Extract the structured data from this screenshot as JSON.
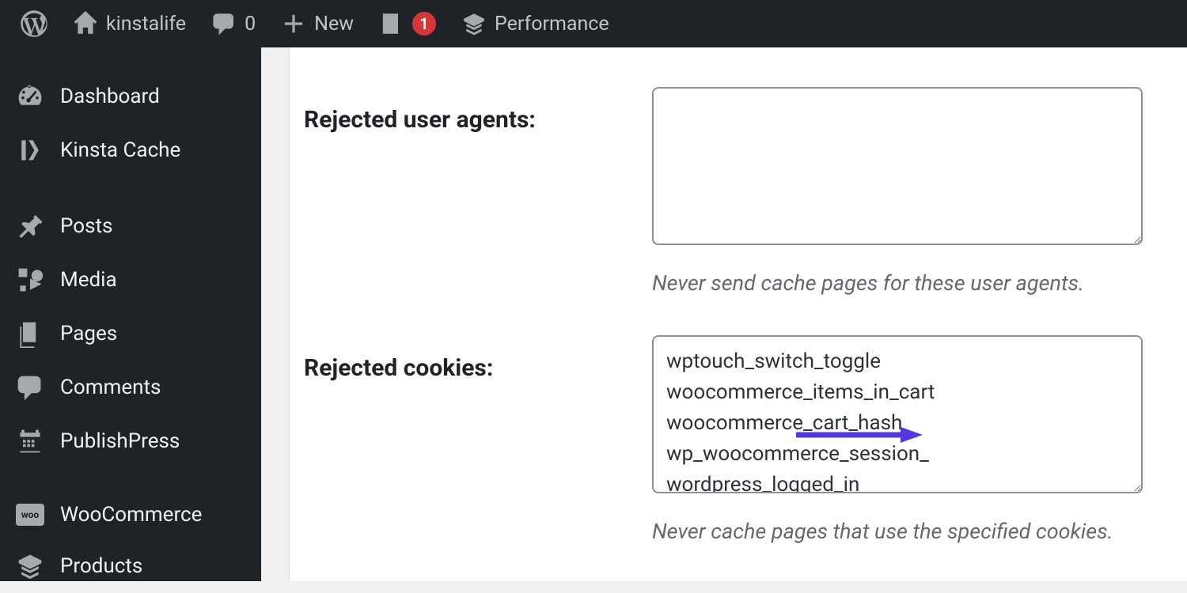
{
  "adminbar": {
    "site_title": "kinstalife",
    "comments_count": "0",
    "new_label": "New",
    "yoast_count": "1",
    "performance_label": "Performance"
  },
  "sidebar": {
    "items": [
      {
        "label": "Dashboard"
      },
      {
        "label": "Kinsta Cache"
      },
      {
        "label": "Posts"
      },
      {
        "label": "Media"
      },
      {
        "label": "Pages"
      },
      {
        "label": "Comments"
      },
      {
        "label": "PublishPress"
      },
      {
        "label": "WooCommerce"
      },
      {
        "label": "Products"
      }
    ],
    "woo_badge": "woo"
  },
  "settings": {
    "rejected_user_agents": {
      "label": "Rejected user agents:",
      "value": "",
      "description": "Never send cache pages for these user agents."
    },
    "rejected_cookies": {
      "label": "Rejected cookies:",
      "value": "wptouch_switch_toggle\nwoocommerce_items_in_cart\nwoocommerce_cart_hash\nwp_woocommerce_session_\nwordpress_logged_in",
      "description": "Never cache pages that use the specified cookies."
    }
  }
}
